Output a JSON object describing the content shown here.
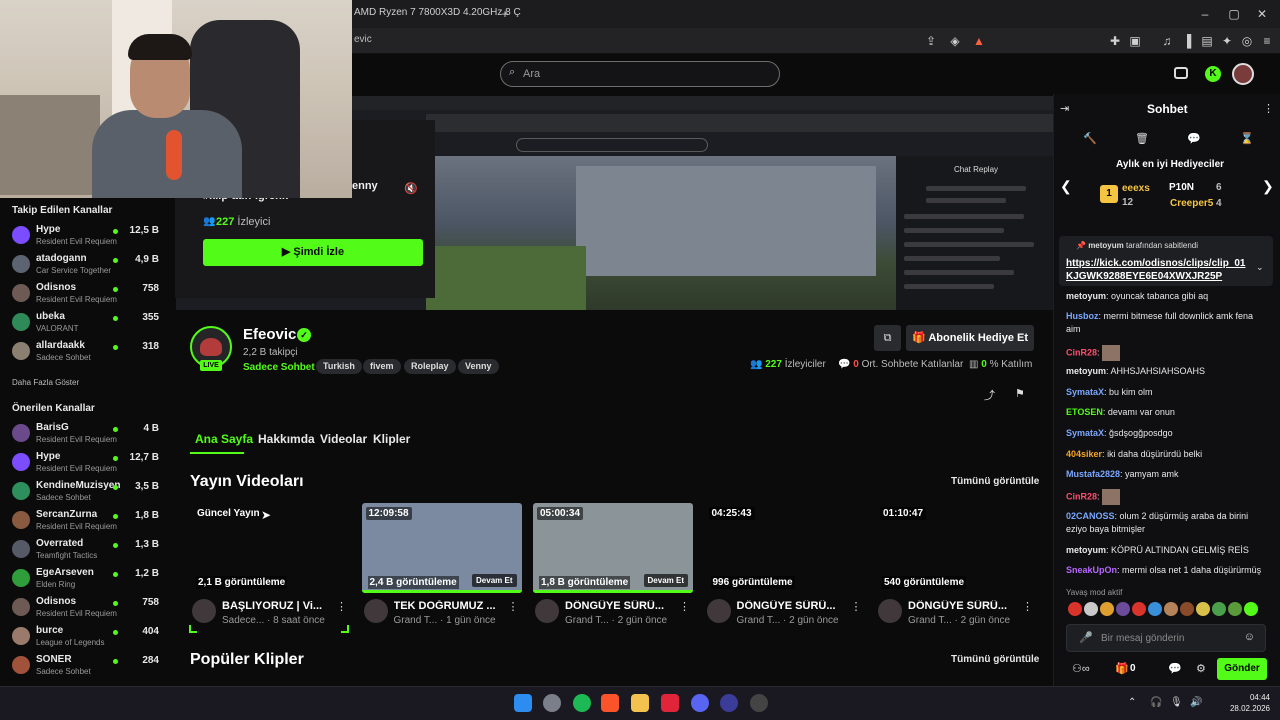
{
  "browser": {
    "tab_title": "AMD Ryzen 7 7800X3D 4.20GHz 8 Ç",
    "new_tab_icon": "plus-icon",
    "url_fragment": "evic"
  },
  "header": {
    "search_placeholder": "Ara"
  },
  "preview": {
    "title": "#klip-atın-igrenk",
    "title_overflow": "enny",
    "viewers": "227",
    "viewers_label": "İzleyici",
    "watch_button": "Şimdi İzle",
    "chat_replay": "Chat Replay"
  },
  "sidebar": {
    "followed_title": "Takip Edilen Kanallar",
    "followed": [
      {
        "name": "Hype",
        "category": "Resident Evil Requiem",
        "count": "12,5 B",
        "color": "#7c4dff"
      },
      {
        "name": "atadogann",
        "category": "Car Service Together",
        "count": "4,9 B",
        "color": "#5b6470"
      },
      {
        "name": "Odisnos",
        "category": "Resident Evil Requiem",
        "count": "758",
        "color": "#6d5a55"
      },
      {
        "name": "ubeka",
        "category": "VALORANT",
        "count": "355",
        "color": "#2e8b57"
      },
      {
        "name": "allardaakk",
        "category": "Sadece Sohbet",
        "count": "318",
        "color": "#8a7f70"
      }
    ],
    "show_more": "Daha Fazla Göster",
    "recommended_title": "Önerilen Kanallar",
    "recommended": [
      {
        "name": "BarisG",
        "category": "Resident Evil Requiem",
        "count": "4 B",
        "color": "#6a4a8a"
      },
      {
        "name": "Hype",
        "category": "Resident Evil Requiem",
        "count": "12,7 B",
        "color": "#7c4dff"
      },
      {
        "name": "KendineMuzisyen",
        "category": "Sadece Sohbet",
        "count": "3,5 B",
        "color": "#2d8f5c"
      },
      {
        "name": "SercanZurna",
        "category": "Resident Evil Requiem",
        "count": "1,8 B",
        "color": "#8a5a40"
      },
      {
        "name": "Overrated",
        "category": "Teamfight Tactics",
        "count": "1,3 B",
        "color": "#555a66"
      },
      {
        "name": "EgeArseven",
        "category": "Elden Ring",
        "count": "1,2 B",
        "color": "#2e9d3a"
      },
      {
        "name": "Odisnos",
        "category": "Resident Evil Requiem",
        "count": "758",
        "color": "#6d5a55"
      },
      {
        "name": "burce",
        "category": "League of Legends",
        "count": "404",
        "color": "#9a7a6a"
      },
      {
        "name": "SONER",
        "category": "Sadece Sohbet",
        "count": "284",
        "color": "#a0523a"
      }
    ]
  },
  "channel": {
    "name": "Efeovic",
    "followers": "2,2 B takipçi",
    "category": "Sadece Sohbet",
    "live": "LIVE",
    "tags": [
      "Turkish",
      "fivem",
      "Roleplay",
      "Venny"
    ],
    "gift_button": "Abonelik Hediye Et",
    "viewers": "227",
    "viewers_label": "İzleyiciler",
    "chatters": "0",
    "chatters_label": "Ort. Sohbete Katılanlar",
    "participation": "0",
    "participation_label": "% Katılım"
  },
  "tabs": [
    "Ana Sayfa",
    "Hakkımda",
    "Videolar",
    "Klipler"
  ],
  "videos_section": {
    "title": "Yayın Videoları",
    "see_all": "Tümünü görüntüle",
    "items": [
      {
        "duration": "Güncel Yayın",
        "views": "2,1 B görüntüleme",
        "title": "BAŞLIYORUZ | Vi...",
        "meta": "Sadece... · 8 saat önce",
        "badge": "",
        "thumb": "#0b0b0c"
      },
      {
        "duration": "12:09:58",
        "views": "2,4 B görüntüleme",
        "title": "TEK DOĞRUMUZ ...",
        "meta": "Grand T... · 1 gün önce",
        "badge": "Devam Et",
        "thumb": "#7b8aa0"
      },
      {
        "duration": "05:00:34",
        "views": "1,8 B görüntüleme",
        "title": "DÖNGÜYE SÜRÜ...",
        "meta": "Grand T... · 2 gün önce",
        "badge": "Devam Et",
        "thumb": "#8a9499"
      },
      {
        "duration": "04:25:43",
        "views": "996 görüntüleme",
        "title": "DÖNGÜYE SÜRÜ...",
        "meta": "Grand T... · 2 gün önce",
        "badge": "",
        "thumb": "#0b0b0c"
      },
      {
        "duration": "01:10:47",
        "views": "540 görüntüleme",
        "title": "DÖNGÜYE SÜRÜ...",
        "meta": "Grand T... · 2 gün önce",
        "badge": "",
        "thumb": "#0b0b0c"
      }
    ]
  },
  "clips_section": {
    "title": "Popüler Klipler",
    "see_all": "Tümünü görüntüle"
  },
  "chat": {
    "title": "Sohbet",
    "top_gifters_title": "Aylık en iyi Hediyeciler",
    "gifters": [
      {
        "name": "eeexs",
        "count": "12",
        "color": "#f5c542"
      },
      {
        "name": "P10N",
        "count": "6",
        "color": "#ffffff"
      },
      {
        "name": "Creeper5",
        "count": "4",
        "color": "#f5c542"
      }
    ],
    "pinned_by": "metoyum",
    "pinned_label": "tarafından sabitlendi",
    "pinned_link": "https://kick.com/odisnos/clips/clip_01KJGWK9288EYE6E04XWXJR25P",
    "messages": [
      {
        "user": "metoyum",
        "color": "#e8e8e8",
        "text": "oyuncak tabanca gibi aq"
      },
      {
        "user": "Husboz",
        "color": "#7aa7ff",
        "text": "mermi bitmese full downlick amk fena aim"
      },
      {
        "user": "CinR28",
        "color": "#ff4d6d",
        "text": ""
      },
      {
        "user": "metoyum",
        "color": "#e8e8e8",
        "text": "AHHSJAHSIAHSOAHS"
      },
      {
        "user": "SymataX",
        "color": "#7aa7ff",
        "text": "bu kim olm"
      },
      {
        "user": "ETOSEN",
        "color": "#53fc18",
        "text": "devamı var onun"
      },
      {
        "user": "SymataX",
        "color": "#7aa7ff",
        "text": "ğsdşogğposdgo"
      },
      {
        "user": "404siker",
        "color": "#f5a623",
        "text": "iki daha düşürürdü belki"
      },
      {
        "user": "Mustafa2828",
        "color": "#7aa7ff",
        "text": "yamyam amk"
      },
      {
        "user": "CinR28",
        "color": "#ff4d6d",
        "text": ""
      },
      {
        "user": "02CANOSS",
        "color": "#7aa7ff",
        "text": "olum 2 düşürmüş araba da birini eziyo baya bitmişler"
      },
      {
        "user": "metoyum",
        "color": "#e8e8e8",
        "text": "KÖPRÜ ALTINDAN GELMİŞ REİS"
      },
      {
        "user": "SneakUpOn",
        "color": "#b667ff",
        "text": "mermi olsa net 1 daha düşürürmüş"
      }
    ],
    "slow_mode": "Yavaş mod aktif",
    "input_placeholder": "Bir mesaj gönderin",
    "points": "0",
    "send_button": "Gönder"
  },
  "taskbar": {
    "time": "04:44",
    "date": "28.02.2026"
  }
}
